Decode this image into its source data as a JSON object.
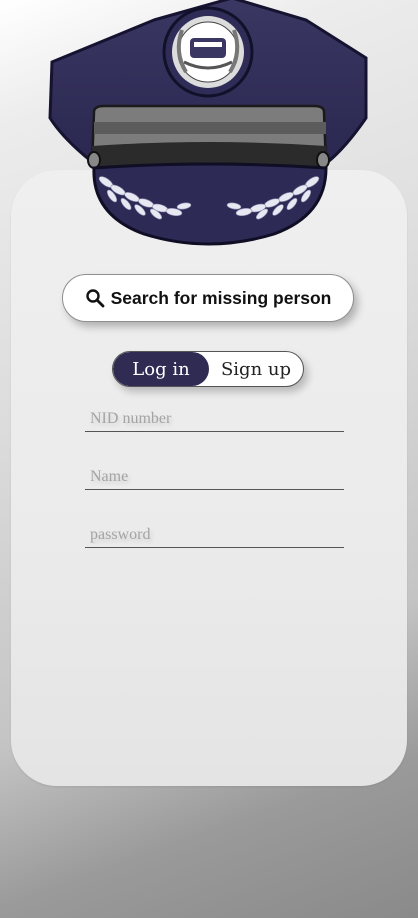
{
  "search": {
    "label": "Search for missing person",
    "icon": "search-icon"
  },
  "auth_toggle": {
    "active_label": "Log in",
    "inactive_label": "Sign up",
    "active_color": "#2f2b52"
  },
  "form": {
    "nid_placeholder": "NID number",
    "name_placeholder": "Name",
    "password_placeholder": "password"
  },
  "logo": {
    "icon": "police-cap-logo"
  }
}
